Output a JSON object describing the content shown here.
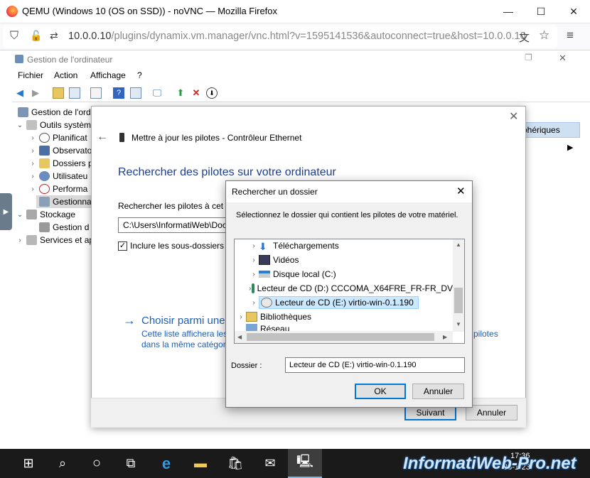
{
  "browser": {
    "title": "QEMU (Windows 10 (OS on SSD)) - noVNC — Mozilla Firefox",
    "url_host": "10.0.0.10",
    "url_rest": "/plugins/dynamix.vm.manager/vnc.html?v=1595141536&autoconnect=true&host=10.0.0.10"
  },
  "mmc": {
    "title": "Gestion de l'ordinateur",
    "menu": [
      "Fichier",
      "Action",
      "Affichage",
      "?"
    ],
    "tree": [
      {
        "label": "Gestion de l'ordi",
        "indent": 0,
        "arrow": ""
      },
      {
        "label": "Outils système",
        "indent": 1,
        "arrow": "⌄"
      },
      {
        "label": "Planificat",
        "indent": 2,
        "arrow": "›"
      },
      {
        "label": "Observato",
        "indent": 2,
        "arrow": "›"
      },
      {
        "label": "Dossiers p",
        "indent": 2,
        "arrow": "›"
      },
      {
        "label": "Utilisateu",
        "indent": 2,
        "arrow": "›"
      },
      {
        "label": "Performa",
        "indent": 2,
        "arrow": "›"
      },
      {
        "label": "Gestionna",
        "indent": 2,
        "arrow": ""
      },
      {
        "label": "Stockage",
        "indent": 1,
        "arrow": "⌄"
      },
      {
        "label": "Gestion d",
        "indent": 2,
        "arrow": ""
      },
      {
        "label": "Services et ap",
        "indent": 1,
        "arrow": "›"
      }
    ],
    "right_header": "ohériques"
  },
  "update_dialog": {
    "header": "Mettre à jour les pilotes - Contrôleur Ethernet",
    "title": "Rechercher des pilotes sur votre ordinateur",
    "search_label": "Rechercher les pilotes à cet e",
    "path_value": "C:\\Users\\InformatiWeb\\Doc",
    "include_subfolders": "Inclure les sous-dossiers",
    "choose_link": "Choisir parmi une",
    "choose_desc_1": "Cette liste affichera les",
    "choose_desc_2": "dans la même catégor",
    "choose_desc_right": "pilotes",
    "next": "Suivant",
    "cancel": "Annuler"
  },
  "browse_dialog": {
    "title": "Rechercher un dossier",
    "instruction": "Sélectionnez le dossier qui contient les pilotes de votre matériel.",
    "items": [
      {
        "label": "Téléchargements",
        "icon": "download-folder-icon"
      },
      {
        "label": "Vidéos",
        "icon": "videos-folder-icon"
      },
      {
        "label": "Disque local (C:)",
        "icon": "drive-icon"
      },
      {
        "label": "Lecteur de CD (D:) CCCOMA_X64FRE_FR-FR_DV",
        "icon": "cd-drive-icon"
      },
      {
        "label": "Lecteur de CD (E:) virtio-win-0.1.190",
        "icon": "cd-drive-icon"
      },
      {
        "label": "Bibliothèques",
        "icon": "libraries-icon"
      },
      {
        "label": "Réseau",
        "icon": "network-icon"
      }
    ],
    "folder_label": "Dossier :",
    "folder_value": "Lecteur de CD (E:) virtio-win-0.1.190",
    "ok": "OK",
    "cancel": "Annuler"
  },
  "taskbar": {
    "time": "17:36",
    "date": "23-1-23",
    "watermark": "InformatiWeb-Pro.net"
  }
}
